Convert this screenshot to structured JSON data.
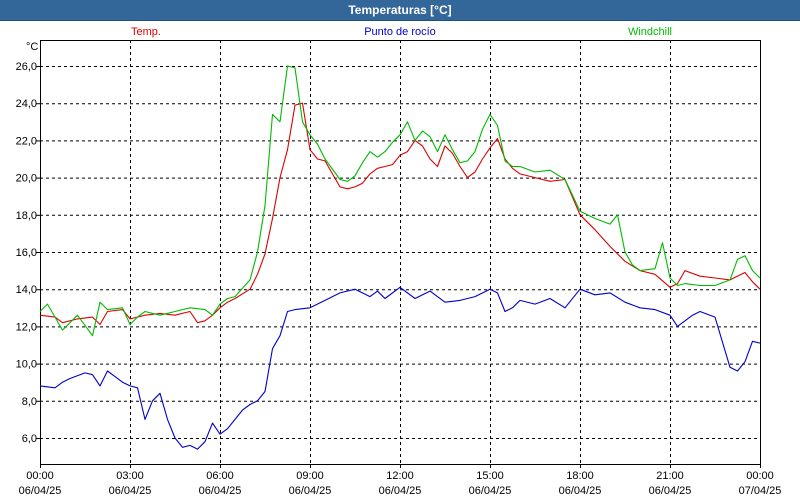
{
  "window": {
    "title": "Temperaturas [°C]"
  },
  "chart_data": {
    "type": "line",
    "title": "Temperaturas [°C]",
    "ylabel": "°C",
    "xlabel": "",
    "ylim": [
      4.6,
      27.4
    ],
    "yticks": [
      6,
      8,
      10,
      12,
      14,
      16,
      18,
      20,
      22,
      24,
      26
    ],
    "ytick_labels": [
      "6,0",
      "8,0",
      "10,0",
      "12,0",
      "14,0",
      "16,0",
      "18,0",
      "20,0",
      "22,0",
      "24,0",
      "26,0"
    ],
    "xlim": [
      0,
      24
    ],
    "xticks": [
      0,
      3,
      6,
      9,
      12,
      15,
      18,
      21,
      24
    ],
    "xtick_labels": [
      {
        "time": "00:00",
        "date": "06/04/25"
      },
      {
        "time": "03:00",
        "date": "06/04/25"
      },
      {
        "time": "06:00",
        "date": "06/04/25"
      },
      {
        "time": "09:00",
        "date": "06/04/25"
      },
      {
        "time": "12:00",
        "date": "06/04/25"
      },
      {
        "time": "15:00",
        "date": "06/04/25"
      },
      {
        "time": "18:00",
        "date": "06/04/25"
      },
      {
        "time": "21:00",
        "date": "06/04/25"
      },
      {
        "time": "00:00",
        "date": "07/04/25"
      }
    ],
    "grid": true,
    "legend": "top",
    "series": [
      {
        "name": "Temp.",
        "color": "#dd0000",
        "x": [
          0,
          0.5,
          0.75,
          1.25,
          1.75,
          2.0,
          2.25,
          2.75,
          3.0,
          3.25,
          3.5,
          4.0,
          4.5,
          5.0,
          5.25,
          5.5,
          5.75,
          6.0,
          6.25,
          6.5,
          7.0,
          7.25,
          7.5,
          7.75,
          8.0,
          8.25,
          8.5,
          8.75,
          9.0,
          9.25,
          9.5,
          10.0,
          10.25,
          10.5,
          10.75,
          11.0,
          11.25,
          11.5,
          11.75,
          12.0,
          12.25,
          12.5,
          12.75,
          13.0,
          13.25,
          13.5,
          13.75,
          14.0,
          14.25,
          14.5,
          14.75,
          15.0,
          15.25,
          15.5,
          15.75,
          16.0,
          16.5,
          17.0,
          17.5,
          18.0,
          18.5,
          19.0,
          19.5,
          20.0,
          20.5,
          21.0,
          21.25,
          21.5,
          22.0,
          22.5,
          23.0,
          23.5,
          23.75,
          24.0
        ],
        "values": [
          12.6,
          12.5,
          12.2,
          12.4,
          12.5,
          12.1,
          12.8,
          12.9,
          12.4,
          12.5,
          12.6,
          12.7,
          12.6,
          12.8,
          12.2,
          12.3,
          12.6,
          13.0,
          13.3,
          13.5,
          14.0,
          14.8,
          15.9,
          17.8,
          20.0,
          21.5,
          23.9,
          24.0,
          21.5,
          21.0,
          20.9,
          19.5,
          19.4,
          19.5,
          19.7,
          20.2,
          20.5,
          20.6,
          20.7,
          21.2,
          21.4,
          22.0,
          21.7,
          21.0,
          20.6,
          21.7,
          21.3,
          20.6,
          20.0,
          20.3,
          21.0,
          21.6,
          22.1,
          21.0,
          20.5,
          20.2,
          20.0,
          19.8,
          19.9,
          18.0,
          17.2,
          16.3,
          15.5,
          15.0,
          14.8,
          14.1,
          14.3,
          15.0,
          14.7,
          14.6,
          14.5,
          14.9,
          14.4,
          14.0
        ]
      },
      {
        "name": "Punto de rocío",
        "color": "#0000cc",
        "x": [
          0,
          0.5,
          0.75,
          1.0,
          1.5,
          1.75,
          2.0,
          2.25,
          2.5,
          2.75,
          3.0,
          3.25,
          3.5,
          3.75,
          4.0,
          4.25,
          4.5,
          4.75,
          5.0,
          5.25,
          5.5,
          5.75,
          6.0,
          6.25,
          6.5,
          6.75,
          7.0,
          7.25,
          7.5,
          7.75,
          8.0,
          8.25,
          8.5,
          9.0,
          9.5,
          10.0,
          10.5,
          11.0,
          11.25,
          11.5,
          12.0,
          12.5,
          13.0,
          13.5,
          14.0,
          14.5,
          15.0,
          15.25,
          15.5,
          15.75,
          16.0,
          16.5,
          17.0,
          17.5,
          18.0,
          18.5,
          19.0,
          19.5,
          20.0,
          20.5,
          21.0,
          21.25,
          21.75,
          22.0,
          22.5,
          23.0,
          23.25,
          23.5,
          23.75,
          24.0
        ],
        "values": [
          8.8,
          8.7,
          9.0,
          9.2,
          9.5,
          9.4,
          8.8,
          9.6,
          9.3,
          9.0,
          8.8,
          8.7,
          7.0,
          8.0,
          8.4,
          7.0,
          6.0,
          5.5,
          5.6,
          5.4,
          5.8,
          6.8,
          6.2,
          6.5,
          7.0,
          7.5,
          7.8,
          8.0,
          8.5,
          10.8,
          11.5,
          12.8,
          12.9,
          13.0,
          13.4,
          13.8,
          14.0,
          13.6,
          13.9,
          13.5,
          14.1,
          13.5,
          13.9,
          13.3,
          13.4,
          13.6,
          14.0,
          13.8,
          12.8,
          13.0,
          13.4,
          13.2,
          13.5,
          13.0,
          14.0,
          13.7,
          13.8,
          13.3,
          13.0,
          12.9,
          12.6,
          12.0,
          12.6,
          12.8,
          12.5,
          9.8,
          9.6,
          10.1,
          11.2,
          11.1
        ]
      },
      {
        "name": "Windchill",
        "color": "#00bb00",
        "x": [
          0,
          0.25,
          0.75,
          1.25,
          1.75,
          2.0,
          2.25,
          2.75,
          3.0,
          3.25,
          3.5,
          4.0,
          4.5,
          5.0,
          5.5,
          5.75,
          6.0,
          6.25,
          6.5,
          7.0,
          7.25,
          7.5,
          7.75,
          8.0,
          8.25,
          8.5,
          8.75,
          9.0,
          9.25,
          9.5,
          10.0,
          10.25,
          10.5,
          10.75,
          11.0,
          11.25,
          11.5,
          11.75,
          12.0,
          12.25,
          12.5,
          12.75,
          13.0,
          13.25,
          13.5,
          13.75,
          14.0,
          14.25,
          14.5,
          14.75,
          15.0,
          15.25,
          15.5,
          15.75,
          16.0,
          16.5,
          17.0,
          17.5,
          18.0,
          18.5,
          19.0,
          19.25,
          19.5,
          19.75,
          20.0,
          20.5,
          20.75,
          21.0,
          21.25,
          21.5,
          22.0,
          22.5,
          23.0,
          23.25,
          23.5,
          23.75,
          24.0
        ],
        "values": [
          12.8,
          13.2,
          11.8,
          12.6,
          11.5,
          13.3,
          12.9,
          13.0,
          12.1,
          12.5,
          12.8,
          12.6,
          12.8,
          13.0,
          12.9,
          12.6,
          13.2,
          13.5,
          13.6,
          14.5,
          16.0,
          18.5,
          23.4,
          23.0,
          26.0,
          25.9,
          23.0,
          22.3,
          21.8,
          21.0,
          19.9,
          19.8,
          20.1,
          20.8,
          21.4,
          21.1,
          21.4,
          21.9,
          22.3,
          23.0,
          22.0,
          22.5,
          22.2,
          21.4,
          22.3,
          21.5,
          20.8,
          20.9,
          21.4,
          22.6,
          23.4,
          22.8,
          20.9,
          20.6,
          20.6,
          20.3,
          20.4,
          19.9,
          18.2,
          17.8,
          17.5,
          18.0,
          16.0,
          15.3,
          15.0,
          15.1,
          16.5,
          14.6,
          14.2,
          14.3,
          14.2,
          14.2,
          14.5,
          15.6,
          15.8,
          15.0,
          14.6
        ]
      }
    ]
  }
}
